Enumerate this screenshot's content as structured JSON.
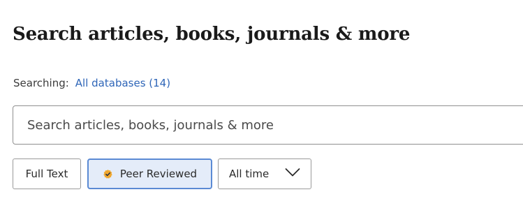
{
  "header": {
    "title": "Search articles, books, journals & more"
  },
  "scope": {
    "label": "Searching:",
    "databases_link": "All databases (14)"
  },
  "search": {
    "placeholder": "Search articles, books, journals & more",
    "value": ""
  },
  "filters": {
    "full_text": {
      "label": "Full Text",
      "selected": false
    },
    "peer_reviewed": {
      "label": "Peer Reviewed",
      "selected": true
    },
    "date_range": {
      "label": "All time"
    }
  },
  "colors": {
    "link": "#2f66b8",
    "selected_border": "#5b8ad4",
    "selected_bg": "#e4ecf9",
    "badge": "#f0a830"
  },
  "icons": {
    "peer_reviewed": "peer-reviewed-check-icon",
    "date_dropdown": "chevron-down-icon"
  }
}
